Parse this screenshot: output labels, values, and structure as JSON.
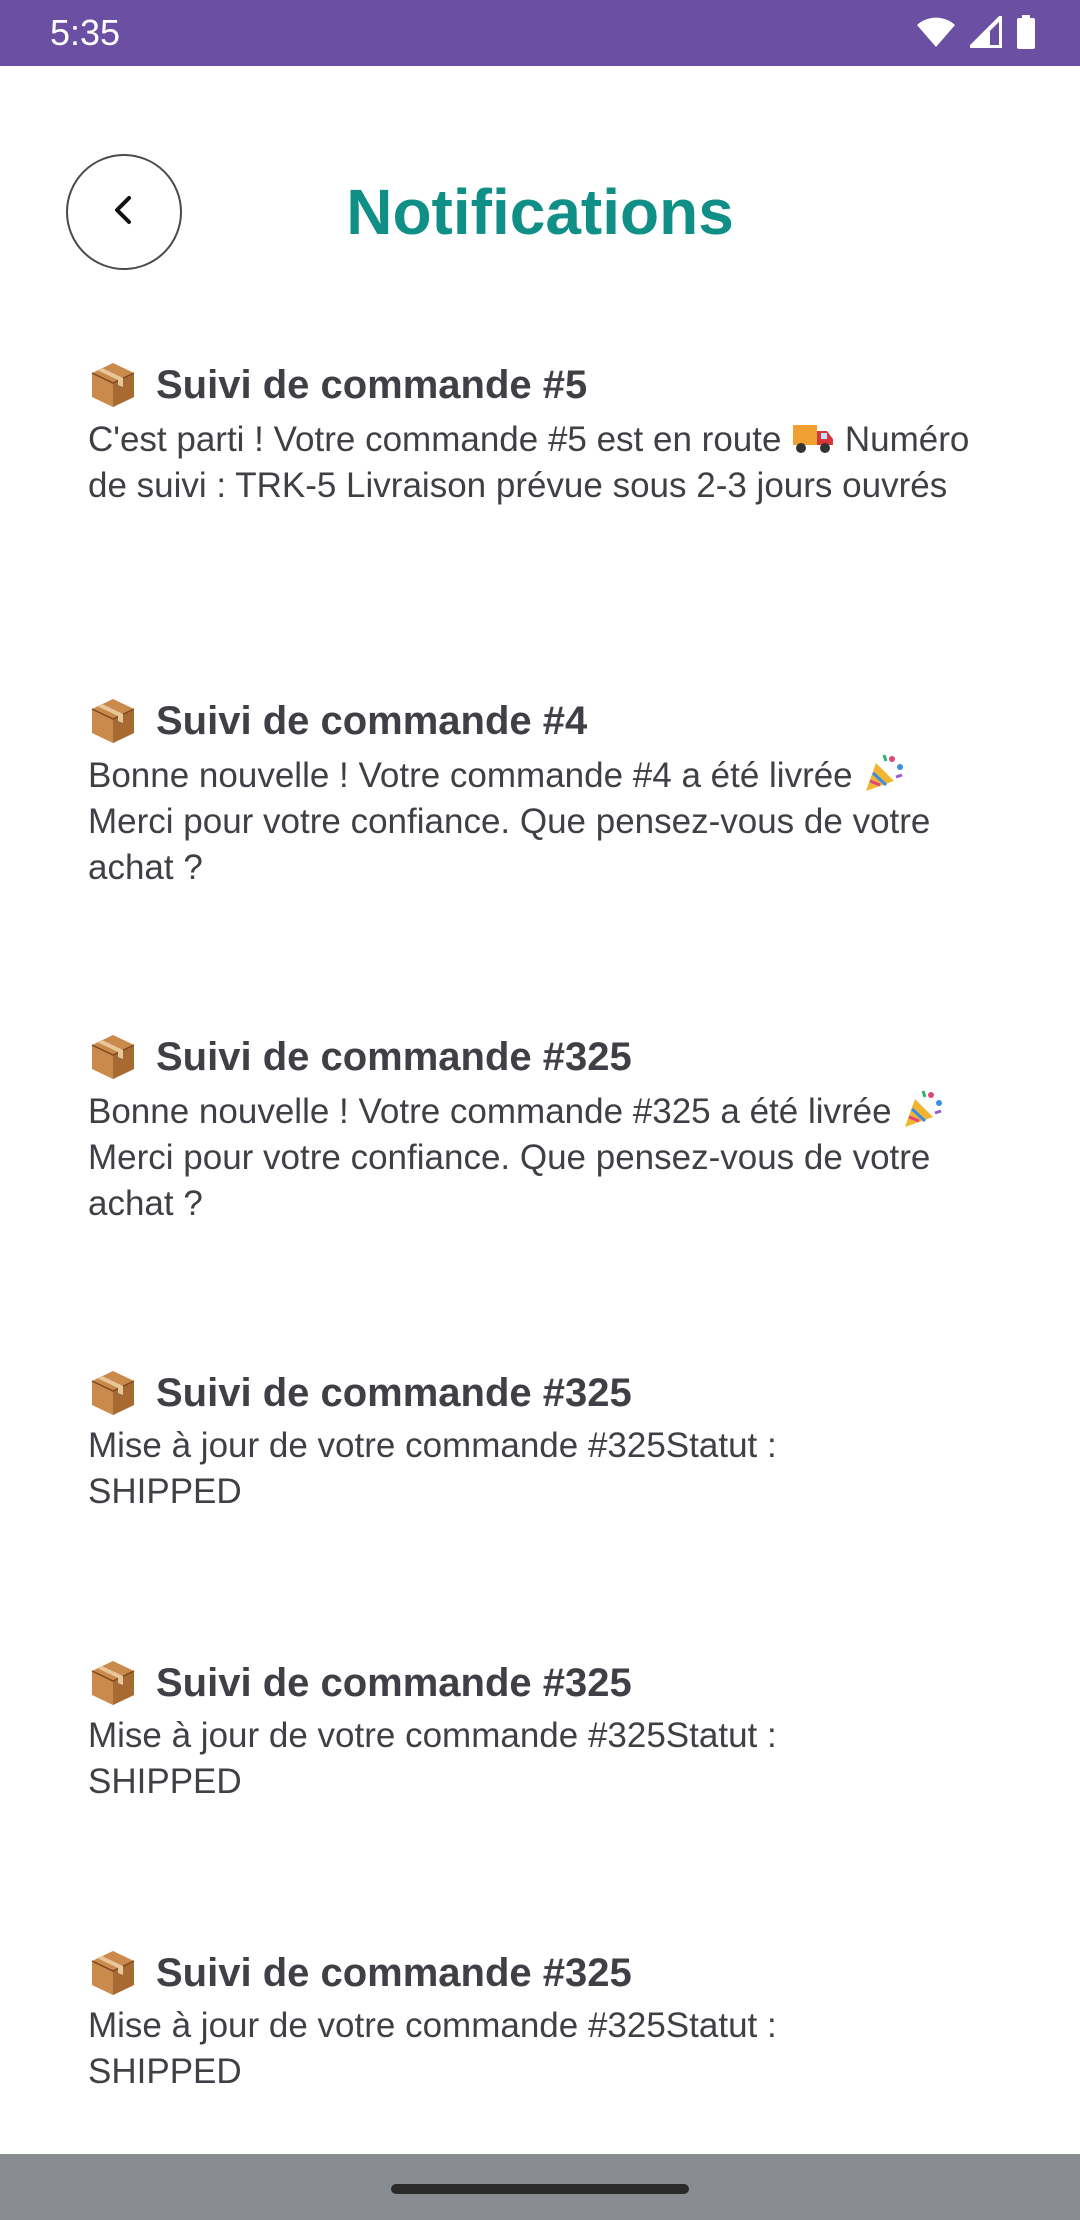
{
  "status_bar": {
    "time": "5:35",
    "icons": [
      "wifi-icon",
      "cellular-signal-icon",
      "battery-icon"
    ],
    "background": "#6a4fa3"
  },
  "header": {
    "back_icon": "chevron-left-icon",
    "title": "Notifications",
    "title_color": "#0f8f85"
  },
  "notifications": [
    {
      "icon": "package-icon",
      "title": "Suivi de commande #5",
      "body_before_emoji": "C'est parti ! Votre commande #5 est en route",
      "emoji": "truck-icon",
      "body_after_emoji": "Numéro de suivi : TRK-5 Livraison prévue sous 2-3 jours ouvrés"
    },
    {
      "icon": "package-icon",
      "title": "Suivi de commande #4",
      "body_before_emoji": "Bonne nouvelle ! Votre commande #4 a été livrée",
      "emoji": "party-popper-icon",
      "body_after_emoji": "Merci pour votre confiance. Que pensez-vous de votre achat ?"
    },
    {
      "icon": "package-icon",
      "title": "Suivi de commande #325",
      "body_before_emoji": "Bonne nouvelle ! Votre commande #325 a été livrée",
      "emoji": "party-popper-icon",
      "body_after_emoji": "Merci pour votre confiance. Que pensez-vous de votre achat ?"
    },
    {
      "icon": "package-icon",
      "title": "Suivi de commande #325",
      "body": "Mise à jour de votre commande #325Statut : SHIPPED"
    },
    {
      "icon": "package-icon",
      "title": "Suivi de commande #325",
      "body": "Mise à jour de votre commande #325Statut : SHIPPED"
    },
    {
      "icon": "package-icon",
      "title": "Suivi de commande #325",
      "body": "Mise à jour de votre commande #325Statut : SHIPPED"
    }
  ]
}
